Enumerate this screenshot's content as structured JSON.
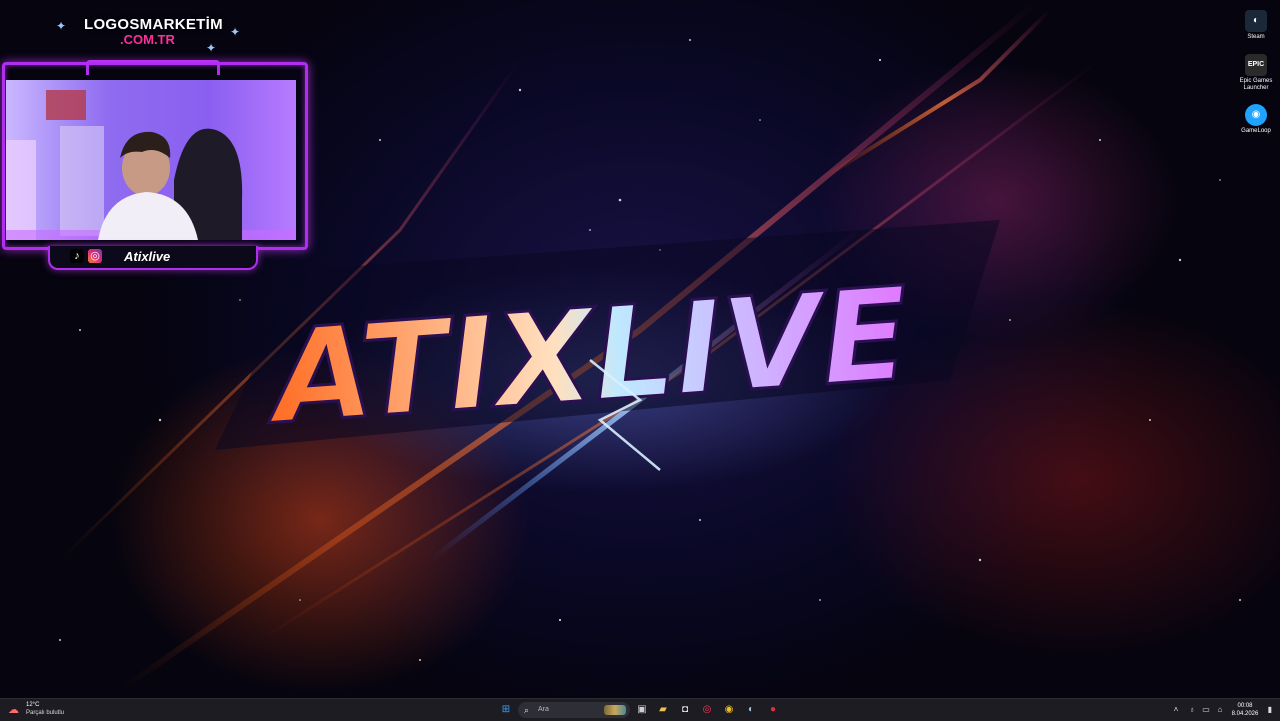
{
  "overlay": {
    "brand_name": "LOGOSMARKETİM",
    "brand_tld": ".COM.TR",
    "streamer_name": "Atixlive",
    "tiktok_label": "TikTok",
    "instagram_label": "IG"
  },
  "wallpaper": {
    "logo_text": "ATIXLIVE"
  },
  "desktop_icons": [
    {
      "label": "Steam",
      "icon": "steam-icon",
      "color": "#1b2838"
    },
    {
      "label": "Epic Games Launcher",
      "icon": "epic-games-icon",
      "color": "#2a2a2a"
    },
    {
      "label": "GameLoop",
      "icon": "gameloop-icon",
      "color": "#1fa3ff"
    }
  ],
  "taskbar": {
    "weather_temp": "12°C",
    "weather_condition": "Parçalı bulutlu",
    "search_placeholder": "Ara",
    "time": "00:08",
    "date": "8.04.2026",
    "apps": [
      {
        "name": "start",
        "icon": "windows-start-icon",
        "glyph": "⊞",
        "color": "#3aa0ff"
      },
      {
        "name": "task-view",
        "icon": "task-view-icon",
        "glyph": "▣",
        "color": "#cfcfcf"
      },
      {
        "name": "file-explorer",
        "icon": "folder-icon",
        "glyph": "▰",
        "color": "#f2c24b"
      },
      {
        "name": "store",
        "icon": "store-icon",
        "glyph": "◘",
        "color": "#e8e8e8"
      },
      {
        "name": "opera",
        "icon": "opera-gx-icon",
        "glyph": "◎",
        "color": "#ff3a5e"
      },
      {
        "name": "chrome",
        "icon": "chrome-icon",
        "glyph": "◉",
        "color": "#f0c020"
      },
      {
        "name": "steam",
        "icon": "steam-icon",
        "glyph": "◐",
        "color": "#9ac0e0"
      },
      {
        "name": "app-red",
        "icon": "red-app-icon",
        "glyph": "●",
        "color": "#e03040"
      }
    ]
  }
}
